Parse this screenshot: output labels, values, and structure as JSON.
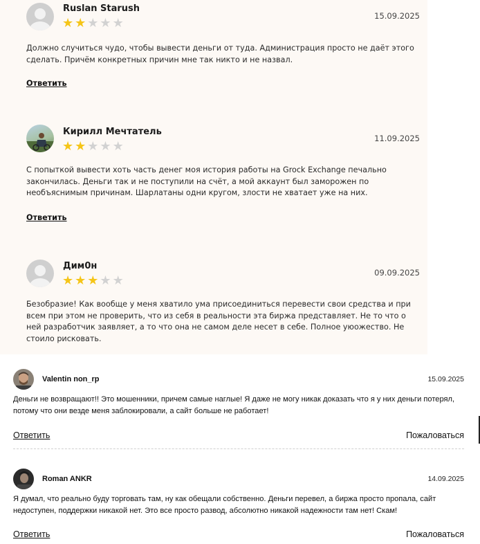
{
  "reviews_top": [
    {
      "author": "Ruslan Starush",
      "date": "15.09.2025",
      "rating": 2,
      "rating_max": 5,
      "text": "Должно случиться чудо, чтобы вывести деньги от туда. Администрация просто не даёт этого сделать. Причём конкретных причин мне так никто и не назвал.",
      "reply_label": "Ответить"
    },
    {
      "author": "Кирилл Мечтатель",
      "date": "11.09.2025",
      "rating": 2,
      "rating_max": 5,
      "text": "С попыткой вывести хоть часть денег моя история работы на Grock Exchange печально закончилась. Деньги так и не поступили на счёт, а мой аккаунт был заморожен по необъяснимым причинам. Шарлатаны одни кругом, злости не хватает уже на них.",
      "reply_label": "Ответить"
    },
    {
      "author": "Дим0н",
      "date": "09.09.2025",
      "rating": 3,
      "rating_max": 5,
      "text": "Безобразие! Как вообще у меня хватило ума присоединиться перевести свои средства и при всем при этом не проверить, что из себя в реальности эта биржа представляет. Не то что о ней разработчик заявляет, а то что она не самом деле несет в себе. Полное уюожество. Не стоило рисковать."
    }
  ],
  "reviews_bottom": [
    {
      "author": "Valentin non_rp",
      "date": "15.09.2025",
      "text": "Деньги не возвращают!! Это мошенники, причем самые наглые! Я даже не могу никак доказать что я у них деньги потерял, потому что они везде меня заблокировали, а сайт больше не работает!",
      "reply_label": "Ответить",
      "report_label": "Пожаловаться"
    },
    {
      "author": "Roman ANKR",
      "date": "14.09.2025",
      "text": "Я думал, что реально буду торговать там, ну как обещали собственно. Деньги перевел, а биржа просто пропала, сайт недоступен, поддержки никакой нет. Это все просто развод, абсолютно никакой надежности там нет! Скам!",
      "reply_label": "Ответить",
      "report_label": "Пожаловаться"
    }
  ],
  "colors": {
    "star_on": "#f5c518",
    "star_off": "#d2d2d2",
    "panel_bg": "#fdf9f5"
  }
}
